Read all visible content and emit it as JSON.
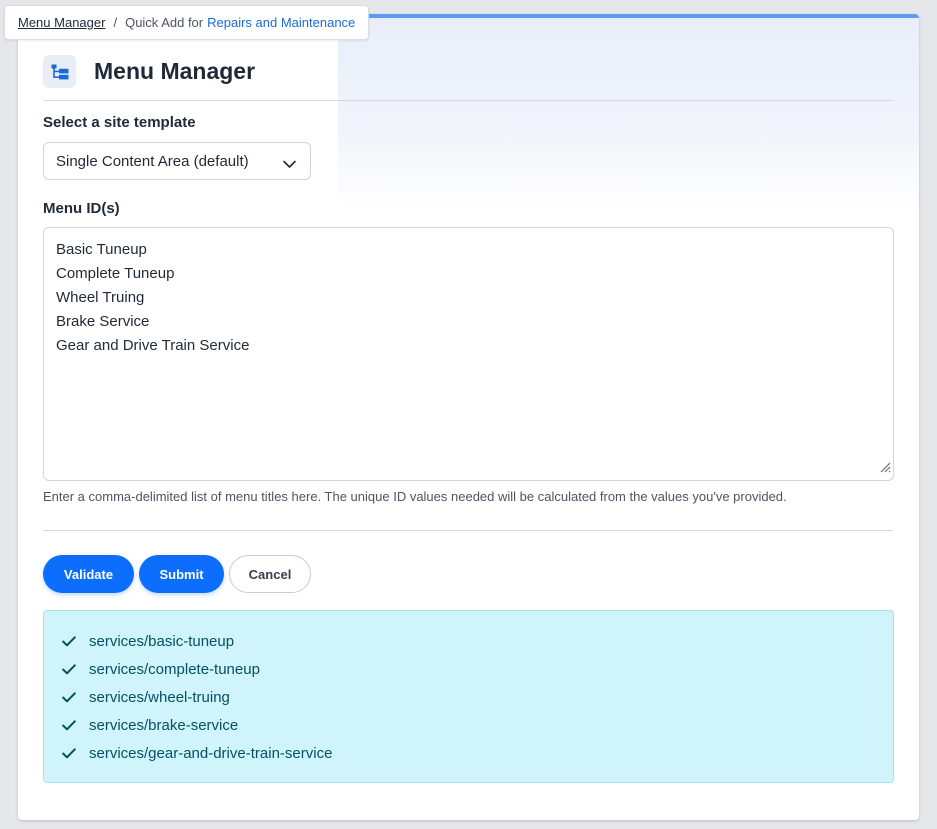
{
  "breadcrumb": {
    "home": "Menu Manager",
    "separator": "/",
    "prefix": "Quick Add for",
    "current": "Repairs and Maintenance"
  },
  "header": {
    "title": "Menu Manager",
    "icon": "sitemap-icon"
  },
  "template_field": {
    "label": "Select a site template",
    "selected": "Single Content Area (default)"
  },
  "menu_ids": {
    "label": "Menu ID(s)",
    "lines": [
      "Basic Tuneup",
      "Complete Tuneup",
      "Wheel Truing",
      "Brake Service",
      "Gear and Drive Train Service"
    ],
    "help": "Enter a comma-delimited list of menu titles here. The unique ID values needed will be calculated from the values you've provided."
  },
  "actions": {
    "validate": "Validate",
    "submit": "Submit",
    "cancel": "Cancel"
  },
  "results": [
    "services/basic-tuneup",
    "services/complete-tuneup",
    "services/wheel-truing",
    "services/brake-service",
    "services/gear-and-drive-train-service"
  ],
  "colors": {
    "primary": "#0d6efd",
    "accent_bar": "#5b9cf5",
    "link": "#1b6ad8",
    "info_bg": "#cff4fc",
    "info_text": "#055160"
  }
}
